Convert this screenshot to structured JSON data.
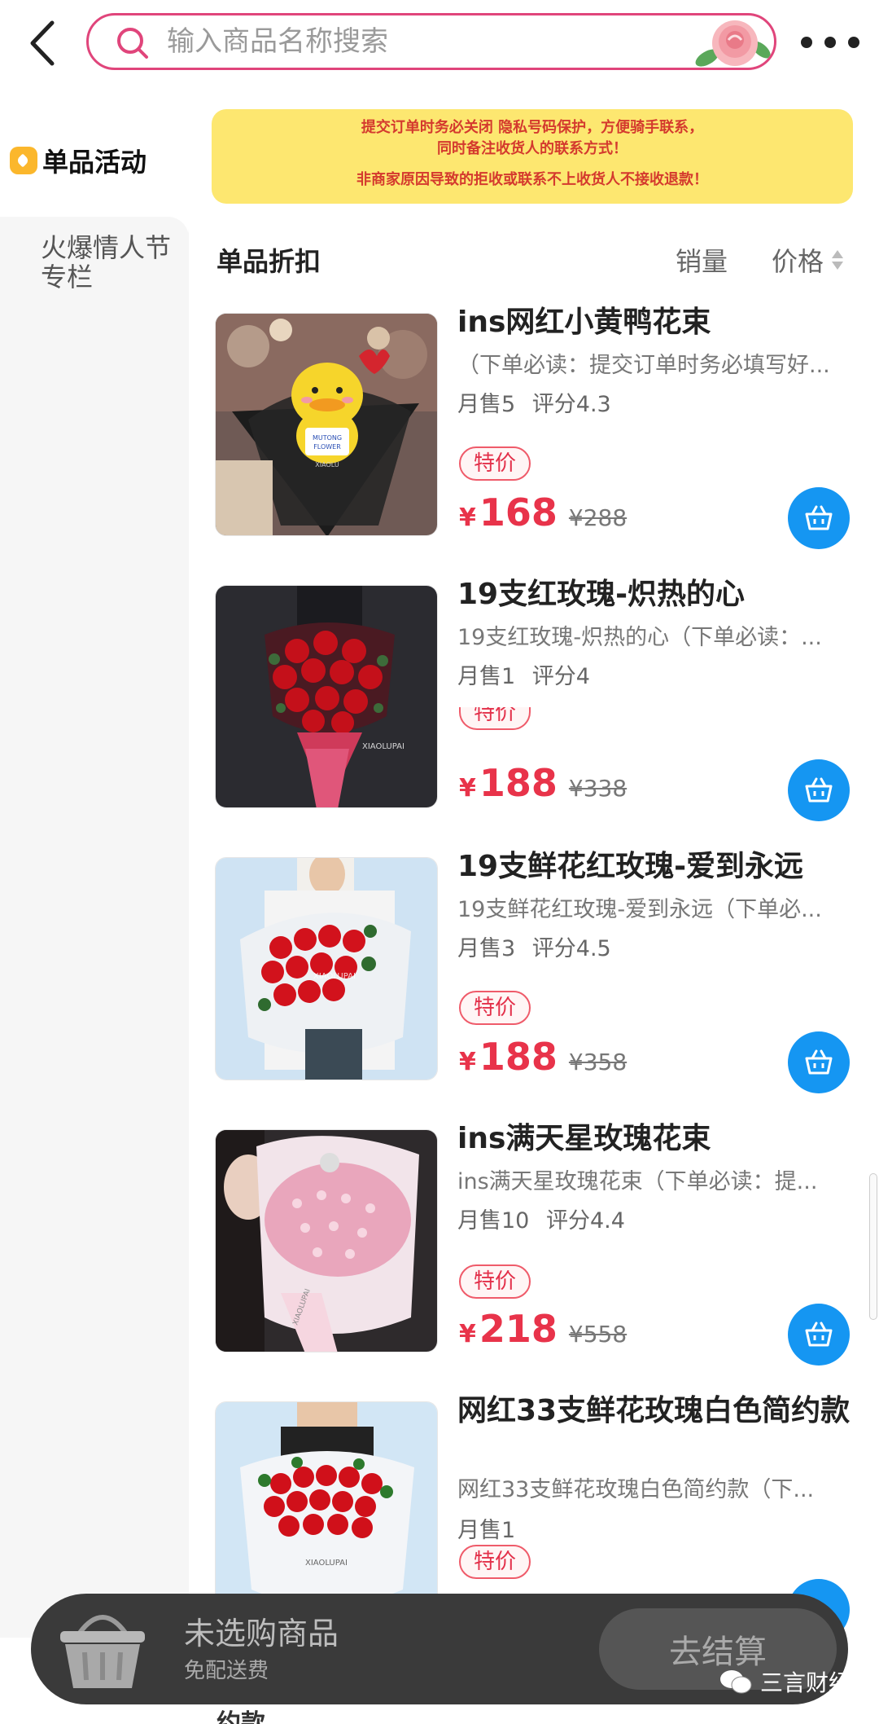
{
  "search": {
    "placeholder": "输入商品名称搜索"
  },
  "sidebar": {
    "active_label": "单品活动",
    "items": [
      {
        "label": "火爆情人节专栏"
      }
    ]
  },
  "notice": {
    "lines": [
      "提交订单时务必关闭 隐私号码保护，方便骑手联系，",
      "同时备注收货人的联系方式！",
      "非商家原因导致的拒收或联系不上收货人不接收退款！"
    ]
  },
  "section": {
    "title": "单品折扣",
    "sort_sales": "销量",
    "sort_price": "价格"
  },
  "products": [
    {
      "name": "ins网红小黄鸭花束",
      "desc": "（下单必读：提交订单时务必填写好...",
      "sales": "月售5",
      "rating": "评分4.3",
      "badge": "特价",
      "currency": "¥",
      "price": "168",
      "orig_price": "¥288"
    },
    {
      "name": "19支红玫瑰-炽热的心",
      "desc": "19支红玫瑰-炽热的心（下单必读：...",
      "sales": "月售1",
      "rating": "评分4",
      "badge": "特价",
      "currency": "¥",
      "price": "188",
      "orig_price": "¥338"
    },
    {
      "name": "19支鲜花红玫瑰-爱到永远",
      "desc": "19支鲜花红玫瑰-爱到永远（下单必...",
      "sales": "月售3",
      "rating": "评分4.5",
      "badge": "特价",
      "currency": "¥",
      "price": "188",
      "orig_price": "¥358"
    },
    {
      "name": "ins满天星玫瑰花束",
      "desc": "ins满天星玫瑰花束（下单必读：提...",
      "sales": "月售10",
      "rating": "评分4.4",
      "badge": "特价",
      "currency": "¥",
      "price": "218",
      "orig_price": "¥558"
    },
    {
      "name": "网红33支鲜花玫瑰白色简约款",
      "desc": "网红33支鲜花玫瑰白色简约款（下...",
      "sales": "月售1",
      "rating": "",
      "badge": "特价",
      "currency": "",
      "price": "",
      "orig_price": ""
    }
  ],
  "image_text": {
    "p1": [
      "MUTONG",
      "FLOWER",
      "XIAOLU"
    ],
    "p2": "XIAOLUPAI",
    "p3": "XIAOLUPAI",
    "p4": "XIAOLUPAI",
    "p5": "XIAOLUPAI"
  },
  "bottom": {
    "cart_status": "未选购商品",
    "delivery": "免配送费",
    "checkout": "去结算"
  },
  "peek_text": "约款",
  "watermark": "三言财经",
  "colors": {
    "accent_pink": "#e0457b",
    "price_red": "#e8334a",
    "cart_blue": "#1596f2",
    "notice_yellow": "#fde770"
  }
}
